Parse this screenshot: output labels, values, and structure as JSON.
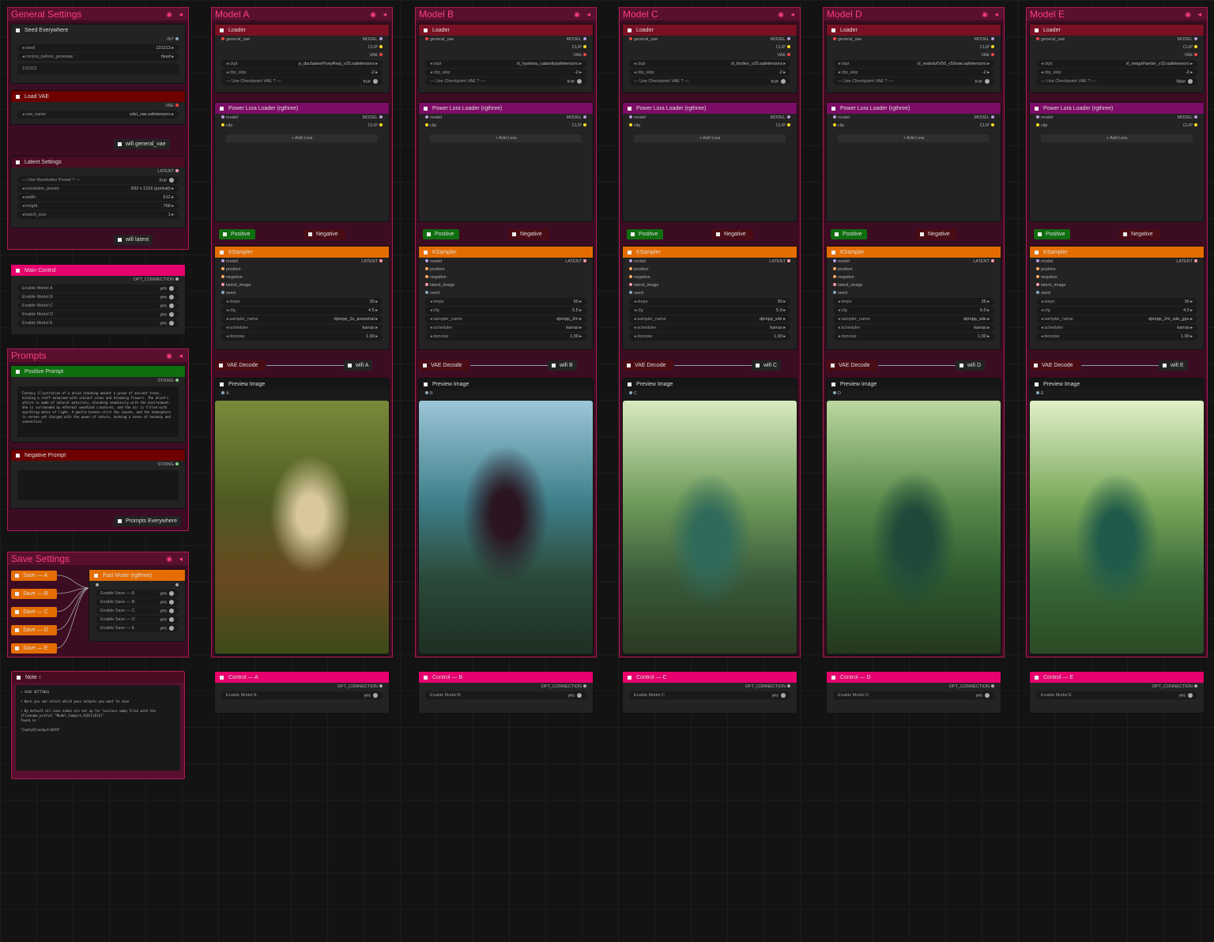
{
  "colors": {
    "group_border": "#b01a55",
    "group_title": "#ff3d7f",
    "pink": "#e6006d",
    "orange": "#e56d00",
    "green": "#0f6e0f",
    "purple": "#7d0c66"
  },
  "general": {
    "title": "General Settings",
    "seed_node": "Seed Everywhere",
    "int_label": "INT",
    "seed_label": "seed",
    "seed_value": "131313",
    "cbg_label": "control_before_generate",
    "cbg_value": "fixed",
    "seed_text": "131313",
    "vae_node": "Load VAE",
    "vae_out": "VAE",
    "vae_name_label": "vae_name",
    "vae_name_value": "sdxl_vae.safetensors",
    "wifi_general": "wifi general_vae",
    "latent_node": "Latent Settings",
    "latent_out": "LATENT",
    "use_preset_label": "— Use Resolution Preset ? —",
    "use_preset_value": "true",
    "res_label": "resolution_preset",
    "res_value": "832 x 1216  (portrait)",
    "width_label": "width",
    "width_value": "512",
    "height_label": "height",
    "height_value": "768",
    "batch_label": "batch_size",
    "batch_value": "1",
    "wifi_latent": "wifi latent"
  },
  "main_control": {
    "title": "Main Control",
    "out": "OPT_CONNECTION",
    "items": [
      {
        "label": "Enable Model A",
        "value": "yes"
      },
      {
        "label": "Enable Model B",
        "value": "yes"
      },
      {
        "label": "Enable Model C",
        "value": "yes"
      },
      {
        "label": "Enable Model D",
        "value": "yes"
      },
      {
        "label": "Enable Model E",
        "value": "yes"
      }
    ]
  },
  "prompts": {
    "title": "Prompts",
    "pos_node": "Positive Prompt",
    "string_label": "STRING",
    "pos_text": "Fantasy illustration of a druid standing amidst a grove of ancient trees, holding a staff entwined with vibrant vines and blooming flowers. The druid's attire is made of natural materials, blending seamlessly with the environment. She is surrounded by ethereal woodland creatures, and the air is filled with sparkling motes of light. A gentle breeze stirs the leaves, and the atmosphere is serene yet charged with the power of nature, evoking a sense of harmony and connection.",
    "neg_node": "Negative Prompt",
    "everywhere": "Prompts Everywhere"
  },
  "save": {
    "title": "Save Settings",
    "buttons": [
      "Save — A",
      "Save — B",
      "Save — C",
      "Save — D",
      "Save — E"
    ],
    "muter": "Fast Muter (rgthree)",
    "items": [
      {
        "label": "Enable Save — A",
        "value": "yes"
      },
      {
        "label": "Enable Save — B",
        "value": "yes"
      },
      {
        "label": "Enable Save — C",
        "value": "yes"
      },
      {
        "label": "Enable Save — D",
        "value": "yes"
      },
      {
        "label": "Enable Save — E",
        "value": "yes"
      }
    ]
  },
  "note": {
    "title": "Note ↑",
    "lines": [
      "• SAVE SETTINGS",
      "",
      "• Here you can select which pass outputs you want to save",
      "",
      "• By default all save nodes are set up for lossless webp files with the",
      "{filename_prefix} \"Model_Compare_A[B|C|D|E]\"",
      "found in :",
      "",
      "\"ComfyUI\\output\\DATE\""
    ]
  },
  "labels": {
    "loader": "Loader",
    "general_vae": "general_vae",
    "model": "MODEL",
    "clip": "CLIP",
    "vae": "VAE",
    "ckpt": "ckpt",
    "clip_skip": "clip_skip",
    "use_ckpt_vae": "— Use Checkpoint VAE ? —",
    "lora_node": "Power Lora Loader (rgthree)",
    "model_in": "model",
    "clip_in": "clip",
    "add_lora": "+ Add Lora",
    "positive": "Positive",
    "negative": "Negative",
    "ksampler": "KSampler",
    "latent": "LATENT",
    "positive_in": "positive",
    "negative_in": "negative",
    "latent_in": "latent_image",
    "seed_in": "seed",
    "steps": "steps",
    "cfg": "cfg",
    "sampler": "sampler_name",
    "scheduler": "scheduler",
    "denoise": "denoise",
    "vae_decode": "VAE Decode",
    "preview": "Preview Image",
    "opt": "OPT_CONNECTION"
  },
  "models": [
    {
      "title": "Model A",
      "letter": "A",
      "ckpt": "p_duchaitenPonyReal_v20.safetensors",
      "clip_skip": "-2",
      "use_vae": "true",
      "steps": "30",
      "cfg": "4.5",
      "sampler": "dpmpp_2s_ancestral",
      "scheduler": "karras",
      "denoise": "1.00",
      "wifi": "wifi A",
      "control": "Control — A",
      "enable": "Enable Model A",
      "enable_value": "yes"
    },
    {
      "title": "Model B",
      "letter": "B",
      "ckpt": "xl_hysteria_calamitysafetensors",
      "clip_skip": "-2",
      "use_vae": "true",
      "steps": "50",
      "cfg": "5.5",
      "sampler": "dpmpp_2m",
      "scheduler": "karras",
      "denoise": "1.00",
      "wifi": "wifi B",
      "control": "Control — B",
      "enable": "Enable Model B",
      "enable_value": "yes"
    },
    {
      "title": "Model C",
      "letter": "C",
      "ckpt": "xl_foolies_v20.safetensors",
      "clip_skip": "-2",
      "use_vae": "true",
      "steps": "30",
      "cfg": "5.0",
      "sampler": "dpmpp_sde",
      "scheduler": "karras",
      "denoise": "1.00",
      "wifi": "wifi C",
      "control": "Control — C",
      "enable": "Enable Model C",
      "enable_value": "yes"
    },
    {
      "title": "Model D",
      "letter": "D",
      "ckpt": "xl_realvisXV50_v50vae.safetensors",
      "clip_skip": "-2",
      "use_vae": "true",
      "steps": "35",
      "cfg": "6.0",
      "sampler": "dpmpp_sde",
      "scheduler": "karras",
      "denoise": "1.00",
      "wifi": "wifi D",
      "control": "Control — D",
      "enable": "Enable Model D",
      "enable_value": "yes"
    },
    {
      "title": "Model E",
      "letter": "E",
      "ckpt": "xl_megaPainter_v10.safetensors",
      "clip_skip": "-2",
      "use_vae": "false",
      "steps": "30",
      "cfg": "4.0",
      "sampler": "dpmpp_2m_sde_gpu",
      "scheduler": "karras",
      "denoise": "1.00",
      "wifi": "wifi E",
      "control": "Control — E",
      "enable": "Enable Model E",
      "enable_value": "yes"
    }
  ]
}
